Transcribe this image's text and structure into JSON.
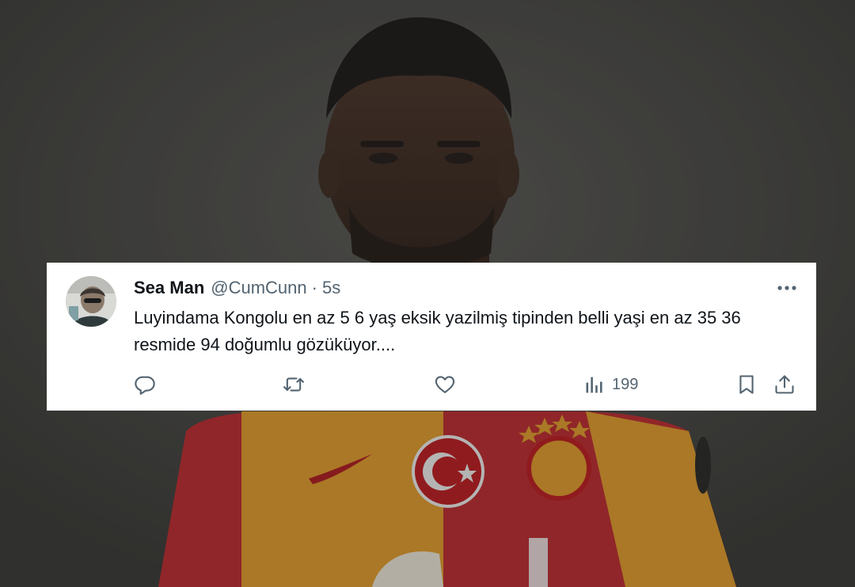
{
  "tweet": {
    "display_name": "Sea Man",
    "handle": "@CumCunn",
    "separator": "·",
    "time": "5s",
    "text": "Luyindama Kongolu en az 5 6 yaş eksik yazilmiş tipinden belli yaşi en az 35 36 resmide 94 doğumlu gözüküyor....",
    "views": "199"
  },
  "icons": {
    "more": "more-horizontal-icon",
    "reply": "reply-icon",
    "retweet": "retweet-icon",
    "like": "like-icon",
    "views": "views-icon",
    "bookmark": "bookmark-icon",
    "share": "share-icon"
  },
  "colors": {
    "card_background": "#ffffff",
    "text_primary": "#0f1419",
    "text_secondary": "#536471",
    "backdrop": "#3d3d3b"
  }
}
